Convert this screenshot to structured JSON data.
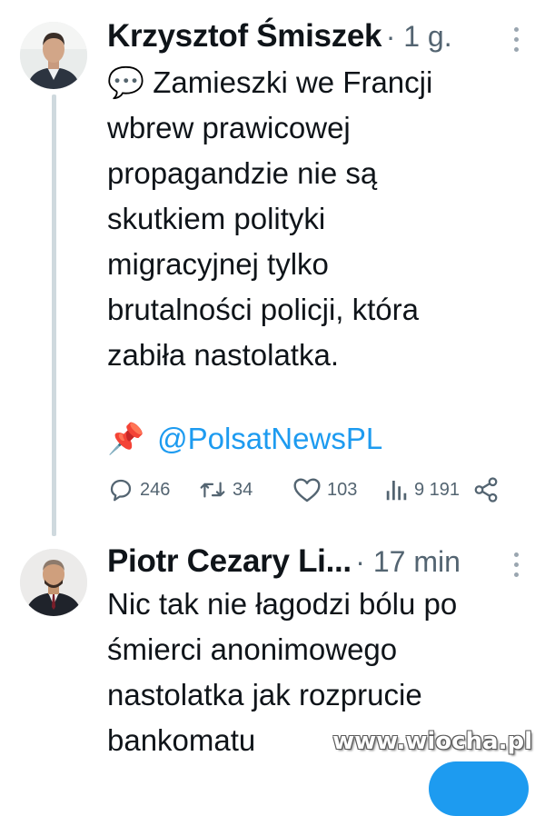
{
  "tweets": [
    {
      "author": "Krzysztof Śmiszek",
      "meta": "· 1 g.",
      "emoji": "💬",
      "text_lines": [
        "Zamieszki we Francji",
        "wbrew prawicowej",
        "propagandzie nie są",
        "skutkiem polityki",
        "migracyjnej tylko",
        "brutalności policji, która",
        "zabiła nastolatka."
      ],
      "pin_emoji": "📌",
      "mention": "@PolsatNewsPL",
      "actions": {
        "replies": "246",
        "retweets": "34",
        "likes": "103",
        "views": "9 191"
      }
    },
    {
      "author": "Piotr Cezary Li...",
      "meta": "· 17 min",
      "text_lines": [
        "Nic tak nie łagodzi bólu po",
        "śmierci anonimowego",
        "nastolatka jak rozprucie",
        "bankomatu"
      ]
    }
  ],
  "watermark": "www.wiocha.pl",
  "colors": {
    "link": "#1d9bf0",
    "muted": "#536471",
    "thread_line": "#cfd9de",
    "text": "#0f1419"
  }
}
